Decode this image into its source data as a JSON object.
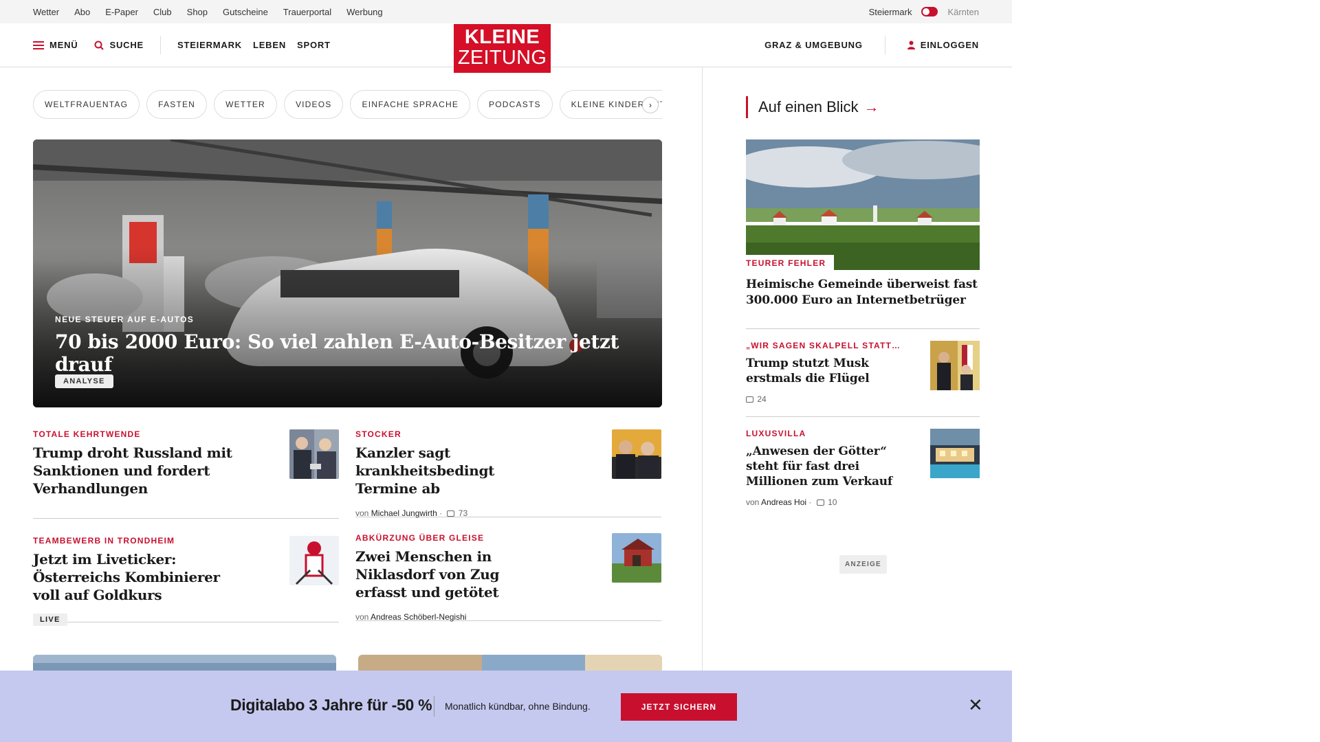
{
  "topbar": {
    "links": [
      "Wetter",
      "Abo",
      "E-Paper",
      "Club",
      "Shop",
      "Gutscheine",
      "Trauerportal",
      "Werbung"
    ],
    "region_active": "Steiermark",
    "region_inactive": "Kärnten"
  },
  "header": {
    "menu_label": "MENÜ",
    "search_label": "SUCHE",
    "nav": [
      "STEIERMARK",
      "LEBEN",
      "SPORT"
    ],
    "logo_line1": "KLEINE",
    "logo_line2": "ZEITUNG",
    "local_label": "GRAZ & UMGEBUNG",
    "login_label": "EINLOGGEN"
  },
  "pills": [
    "WELTFRAUENTAG",
    "FASTEN",
    "WETTER",
    "VIDEOS",
    "EINFACHE SPRACHE",
    "PODCASTS",
    "KLEINE KINDERZEITUNG"
  ],
  "pill_next": "›",
  "hero": {
    "kicker": "NEUE STEUER AUF E-AUTOS",
    "title": "70 bis 2000 Euro: So viel zahlen E-Auto-Besitzer jetzt drauf",
    "badge": "ANALYSE"
  },
  "teasers": [
    {
      "kicker": "TOTALE KEHRTWENDE",
      "title": "Trump droht Russland mit Sanktionen und fordert Verhandlungen"
    },
    {
      "kicker": "STOCKER",
      "title": "Kanzler sagt krankheitsbedingt Termine ab",
      "by": "von",
      "author": "Michael Jungwirth",
      "sep": "·",
      "comments": "73"
    },
    {
      "kicker": "TEAMBEWERB IN TRONDHEIM",
      "title": "Jetzt im Liveticker: Österreichs Kombinierer voll auf Goldkurs",
      "badge": "LIVE"
    },
    {
      "kicker": "ABKÜRZUNG ÜBER GLEISE",
      "title": "Zwei Menschen in Niklasdorf von Zug erfasst und getötet",
      "by": "von",
      "author": "Andreas Schöberl-Negishi"
    }
  ],
  "sidebar": {
    "heading": "Auf einen Blick",
    "arrow": "→",
    "main": {
      "kicker": "TEURER FEHLER",
      "title": "Heimische Gemeinde überweist fast 300.000 Euro an Internetbetrüger"
    },
    "items": [
      {
        "kicker": "„WIR SAGEN SKALPELL STATT…",
        "title": "Trump stutzt Musk erstmals die Flügel",
        "comments": "24"
      },
      {
        "kicker": "LUXUSVILLA",
        "title": "„Anwesen der Götter“ steht für fast drei Millionen zum Verkauf",
        "by": "von",
        "author": "Andreas Hoi",
        "sep": "·",
        "comments": "10"
      }
    ],
    "ad_label": "ANZEIGE"
  },
  "promo": {
    "title": "Digitalabo 3 Jahre für -50 %",
    "subtitle": "Monatlich kündbar, ohne Bindung.",
    "cta": "JETZT SICHERN",
    "close": "✕"
  },
  "colors": {
    "brand_red": "#d50f27",
    "accent_red": "#c8102e",
    "promo_bg": "#c5c9ef"
  }
}
